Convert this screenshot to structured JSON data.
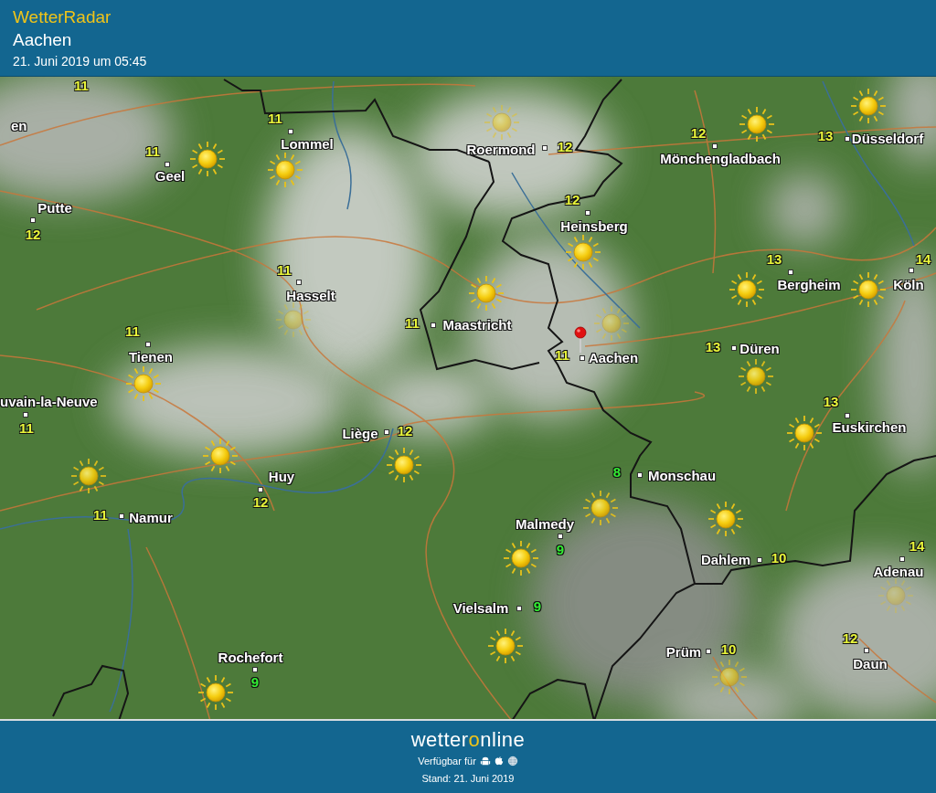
{
  "header": {
    "app_title": "WetterRadar",
    "location": "Aachen",
    "timestamp": "21. Juni 2019 um 05:45"
  },
  "map": {
    "places": [
      {
        "name": "en"
      },
      {
        "temp": "11"
      },
      {
        "name": "Geel",
        "temp": "11"
      },
      {
        "name": "Lommel",
        "temp": "11"
      },
      {
        "name": "Putte",
        "temp": "12"
      },
      {
        "name": "Hasselt",
        "temp": "11"
      },
      {
        "name": "Maastricht",
        "temp": "11"
      },
      {
        "name": "Tienen",
        "temp": "11"
      },
      {
        "name": "Roermond",
        "temp": "12"
      },
      {
        "name": "Mönchengladbach",
        "temp": "12"
      },
      {
        "name": "Düsseldorf",
        "temp": "13"
      },
      {
        "name": "Heinsberg",
        "temp": "12"
      },
      {
        "name": "Bergheim",
        "temp": "13"
      },
      {
        "name": "Köln",
        "temp": "14"
      },
      {
        "name": "Aachen",
        "temp": "11",
        "pinned": true
      },
      {
        "name": "Düren",
        "temp": "13"
      },
      {
        "name": "uvain-la-Neuve",
        "temp": "11"
      },
      {
        "name": "Euskirchen",
        "temp": "13"
      },
      {
        "name": "Liège",
        "temp": "12"
      },
      {
        "name": "Huy",
        "temp": "12"
      },
      {
        "name": "Namur",
        "temp": "11"
      },
      {
        "name": "Monschau",
        "temp": "8",
        "color": "#33ee33"
      },
      {
        "name": "Malmedy",
        "temp": "9",
        "color": "#33ee33"
      },
      {
        "name": "Dahlem",
        "temp": "10"
      },
      {
        "name": "Adenau",
        "temp": "14"
      },
      {
        "name": "Vielsalm",
        "temp": "9",
        "color": "#33ee33"
      },
      {
        "name": "Prüm",
        "temp": "10"
      },
      {
        "name": "Daun",
        "temp": "12"
      },
      {
        "name": "Rochefort",
        "temp": "9",
        "color": "#33ee33"
      }
    ]
  },
  "footer": {
    "logo_parts": [
      {
        "text": "wetter",
        "kind": "plain"
      },
      {
        "text": "o",
        "kind": "ring"
      },
      {
        "text": "nline",
        "kind": "plain"
      }
    ],
    "availability": "Verfügbar für",
    "platforms": [
      {
        "kind": "android"
      },
      {
        "kind": "apple"
      },
      {
        "kind": "web"
      }
    ],
    "updated": "Stand: 21. Juni 2019"
  }
}
